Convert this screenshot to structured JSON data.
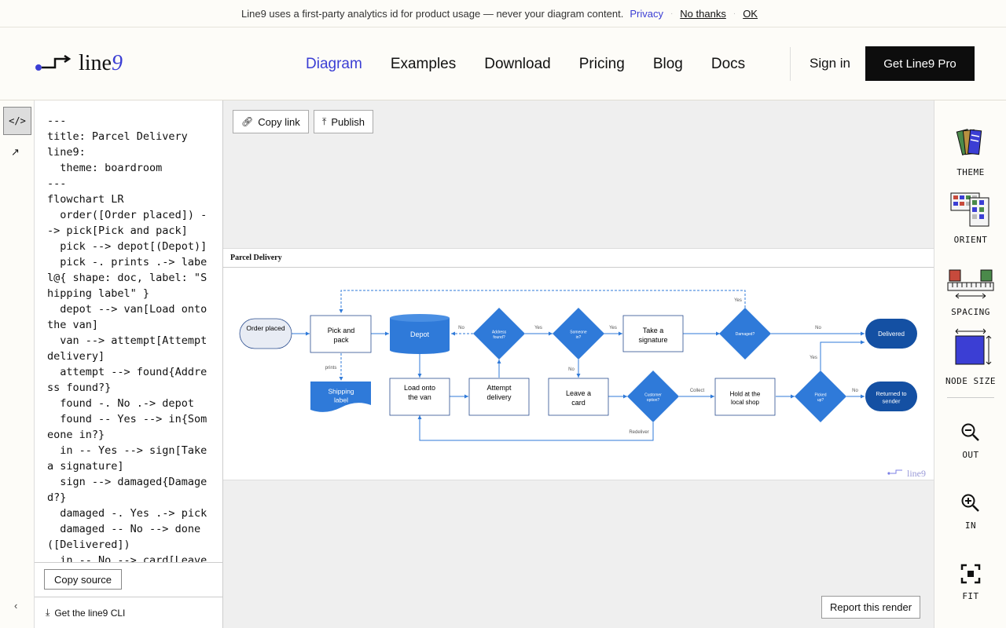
{
  "banner": {
    "message": "Line9 uses a first-party analytics id for product usage — never your diagram content.",
    "privacy": "Privacy",
    "no_thanks": "No thanks",
    "ok": "OK"
  },
  "brand": {
    "name": "line",
    "nine": "9"
  },
  "nav": [
    "Diagram",
    "Examples",
    "Download",
    "Pricing",
    "Blog",
    "Docs"
  ],
  "nav_active": "Diagram",
  "header": {
    "sign_in": "Sign in",
    "cta": "Get Line9 Pro"
  },
  "rail": {
    "code_icon": "</>",
    "expand_icon": "↗",
    "collapse_icon": "‹"
  },
  "source": {
    "code": "---\ntitle: Parcel Delivery\nline9:\n  theme: boardroom\n---\nflowchart LR\n  order([Order placed]) --> pick[Pick and pack]\n  pick --> depot[(Depot)]\n  pick -. prints .-> label@{ shape: doc, label: \"Shipping label\" }\n  depot --> van[Load onto the van]\n  van --> attempt[Attempt delivery]\n  attempt --> found{Address found?}\n  found -. No .-> depot\n  found -- Yes --> in{Someone in?}\n  in -- Yes --> sign[Take a signature]\n  sign --> damaged{Damaged?}\n  damaged -. Yes .-> pick\n  damaged -- No --> done([Delivered])\n  in -- No --> card[Leave a card]",
    "copy_source": "Copy source",
    "cli": "Get the line9 CLI"
  },
  "canvas": {
    "copy_link": "Copy link",
    "publish": "Publish",
    "report": "Report this render"
  },
  "diagram": {
    "title": "Parcel Delivery",
    "watermark": "line9",
    "nodes": {
      "order": "Order placed",
      "pick": "Pick and pack",
      "depot": "Depot",
      "label": "Shipping label",
      "van": "Load onto the van",
      "attempt": "Attempt delivery",
      "found": "Address found?",
      "in": "Someone in?",
      "sign": "Take a signature",
      "damaged": "Damaged?",
      "done": "Delivered",
      "card": "Leave a card",
      "customer": "Customer option?",
      "shop": "Hold at the local shop",
      "picked": "Picked up?",
      "returned": "Returned to sender"
    },
    "edges": {
      "prints": "prints",
      "no": "No",
      "yes": "Yes",
      "collect": "Collect",
      "redeliver": "Redeliver"
    },
    "colors": {
      "node_fill": "#ffffff",
      "node_stroke": "#2a4d8f",
      "accent": "#2f7ad9",
      "terminal": "#1450a3",
      "start_fill": "#e8ecf4"
    }
  },
  "tools": [
    "THEME",
    "ORIENT",
    "SPACING",
    "NODE SIZE",
    "OUT",
    "IN",
    "FIT"
  ]
}
